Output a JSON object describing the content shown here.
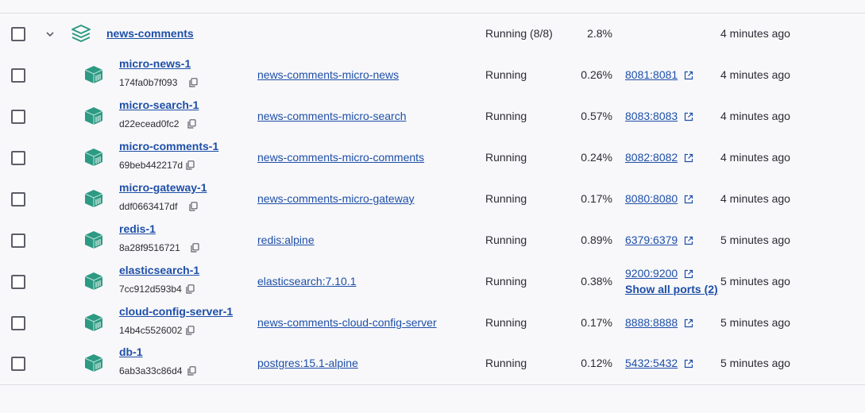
{
  "group": {
    "name": "news-comments",
    "status": "Running (8/8)",
    "cpu": "2.8%",
    "started": "4 minutes ago"
  },
  "containers": [
    {
      "name": "micro-news-1",
      "id": "174fa0b7f093",
      "image": "news-comments-micro-news",
      "status": "Running",
      "cpu": "0.26%",
      "port": "8081:8081",
      "started": "4 minutes ago"
    },
    {
      "name": "micro-search-1",
      "id": "d22ecead0fc2",
      "image": "news-comments-micro-search",
      "status": "Running",
      "cpu": "0.57%",
      "port": "8083:8083",
      "started": "4 minutes ago"
    },
    {
      "name": "micro-comments-1",
      "id": "69beb442217d",
      "image": "news-comments-micro-comments",
      "status": "Running",
      "cpu": "0.24%",
      "port": "8082:8082",
      "started": "4 minutes ago"
    },
    {
      "name": "micro-gateway-1",
      "id": "ddf0663417df",
      "image": "news-comments-micro-gateway",
      "status": "Running",
      "cpu": "0.17%",
      "port": "8080:8080",
      "started": "4 minutes ago"
    },
    {
      "name": "redis-1",
      "id": "8a28f9516721",
      "image": "redis:alpine",
      "status": "Running",
      "cpu": "0.89%",
      "port": "6379:6379",
      "started": "5 minutes ago"
    },
    {
      "name": "elasticsearch-1",
      "id": "7cc912d593b4",
      "image": "elasticsearch:7.10.1",
      "status": "Running",
      "cpu": "0.38%",
      "port": "9200:9200",
      "show_all": "Show all ports (2)",
      "started": "5 minutes ago"
    },
    {
      "name": "cloud-config-server-1",
      "id": "14b4c5526002",
      "image": "news-comments-cloud-config-server",
      "status": "Running",
      "cpu": "0.17%",
      "port": "8888:8888",
      "started": "5 minutes ago"
    },
    {
      "name": "db-1",
      "id": "6ab3a33c86d4",
      "image": "postgres:15.1-alpine",
      "status": "Running",
      "cpu": "0.12%",
      "port": "5432:5432",
      "started": "5 minutes ago"
    }
  ],
  "colors": {
    "link": "#1e4fa8",
    "container_icon": "#2d9a83"
  }
}
